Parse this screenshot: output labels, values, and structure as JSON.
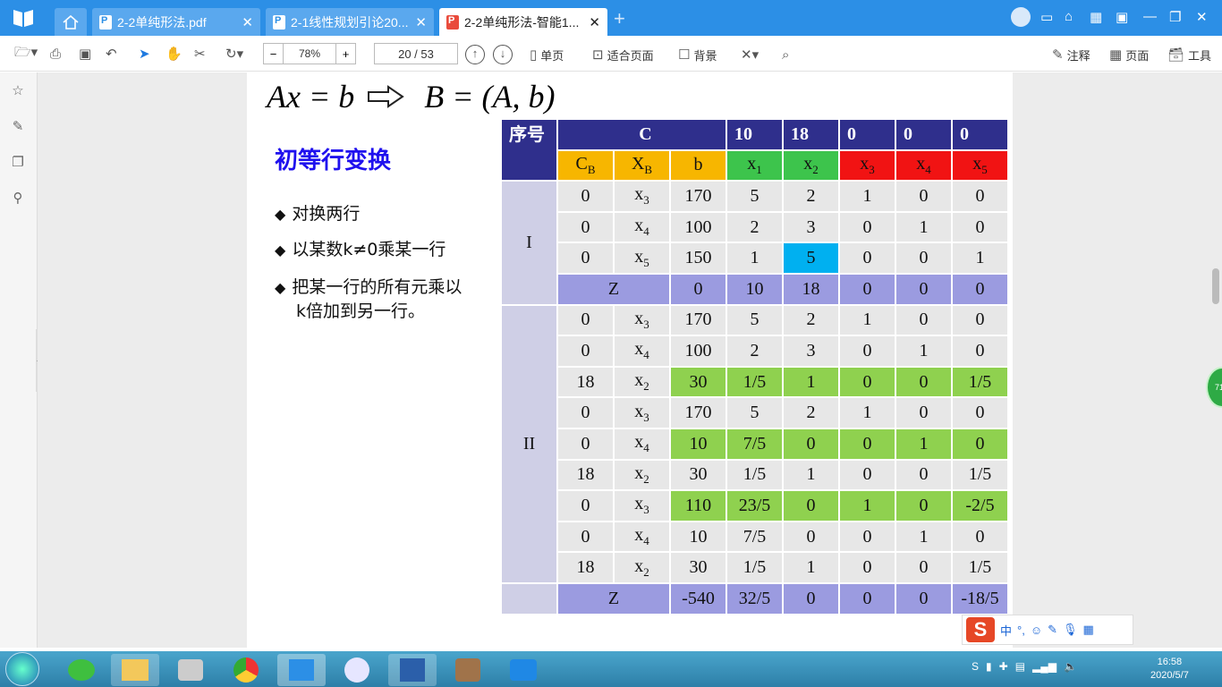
{
  "tabs": [
    {
      "label": "2-2单纯形法.pdf",
      "active": false
    },
    {
      "label": "2-1线性规划引论20...",
      "active": false
    },
    {
      "label": "2-2单纯形法-智能1...",
      "active": true
    }
  ],
  "toolbar": {
    "zoom_minus": "−",
    "zoom": "78%",
    "zoom_plus": "+",
    "page": "20   /  53",
    "single_page": "单页",
    "fit_page": "适合页面",
    "background": "背景",
    "annotate": "注释",
    "pages": "页面",
    "tools": "工具"
  },
  "doc": {
    "formula_left": "Ax = b",
    "formula_right": "B = (A, b)",
    "heading": "初等行变换",
    "bullets": [
      "对换两行",
      "以某数k≠0乘某一行",
      "把某一行的所有元乘以",
      "k倍加到另一行。"
    ]
  },
  "table": {
    "h_seq": "序号",
    "h_c": "C",
    "h_costs": [
      "10",
      "18",
      "0",
      "0",
      "0"
    ],
    "cb": "C",
    "cb_sub": "B",
    "xb": "X",
    "xb_sub": "B",
    "b": "b",
    "x": [
      "x",
      "x",
      "x",
      "x",
      "x"
    ],
    "x_sub": [
      "1",
      "2",
      "3",
      "4",
      "5"
    ],
    "sec1": "I",
    "sec2": "II",
    "z": "Z",
    "rows": [
      [
        "0",
        "x",
        "3",
        "170",
        "5",
        "2",
        "1",
        "0",
        "0"
      ],
      [
        "0",
        "x",
        "4",
        "100",
        "2",
        "3",
        "0",
        "1",
        "0"
      ],
      [
        "0",
        "x",
        "5",
        "150",
        "1",
        "5",
        "0",
        "0",
        "1"
      ],
      [
        "",
        "",
        "",
        "0",
        "10",
        "18",
        "0",
        "0",
        "0"
      ],
      [
        "0",
        "x",
        "3",
        "170",
        "5",
        "2",
        "1",
        "0",
        "0"
      ],
      [
        "0",
        "x",
        "4",
        "100",
        "2",
        "3",
        "0",
        "1",
        "0"
      ],
      [
        "18",
        "x",
        "2",
        "30",
        "1/5",
        "1",
        "0",
        "0",
        "1/5"
      ],
      [
        "0",
        "x",
        "3",
        "170",
        "5",
        "2",
        "1",
        "0",
        "0"
      ],
      [
        "0",
        "x",
        "4",
        "10",
        "7/5",
        "0",
        "0",
        "1",
        "0"
      ],
      [
        "18",
        "x",
        "2",
        "30",
        "1/5",
        "1",
        "0",
        "0",
        "1/5"
      ],
      [
        "0",
        "x",
        "3",
        "110",
        "23/5",
        "0",
        "1",
        "0",
        "-2/5"
      ],
      [
        "0",
        "x",
        "4",
        "10",
        "7/5",
        "0",
        "0",
        "1",
        "0"
      ],
      [
        "18",
        "x",
        "2",
        "30",
        "1/5",
        "1",
        "0",
        "0",
        "1/5"
      ],
      [
        "",
        "",
        "",
        "-540",
        "32/5",
        "0",
        "0",
        "0",
        "-18/5"
      ]
    ]
  },
  "ime": {
    "lang": "中"
  },
  "green_badge": "71",
  "clock": {
    "time": "16:58",
    "date": "2020/5/7"
  },
  "colors": {
    "accent": "#2c8fe6",
    "header": "#2f2f8c",
    "yellow": "#f7b600",
    "green": "#3dc44c",
    "red": "#f11313",
    "zrow": "#9b9be0",
    "highlight": "#8fd14f",
    "pivot": "#00b0f0"
  }
}
